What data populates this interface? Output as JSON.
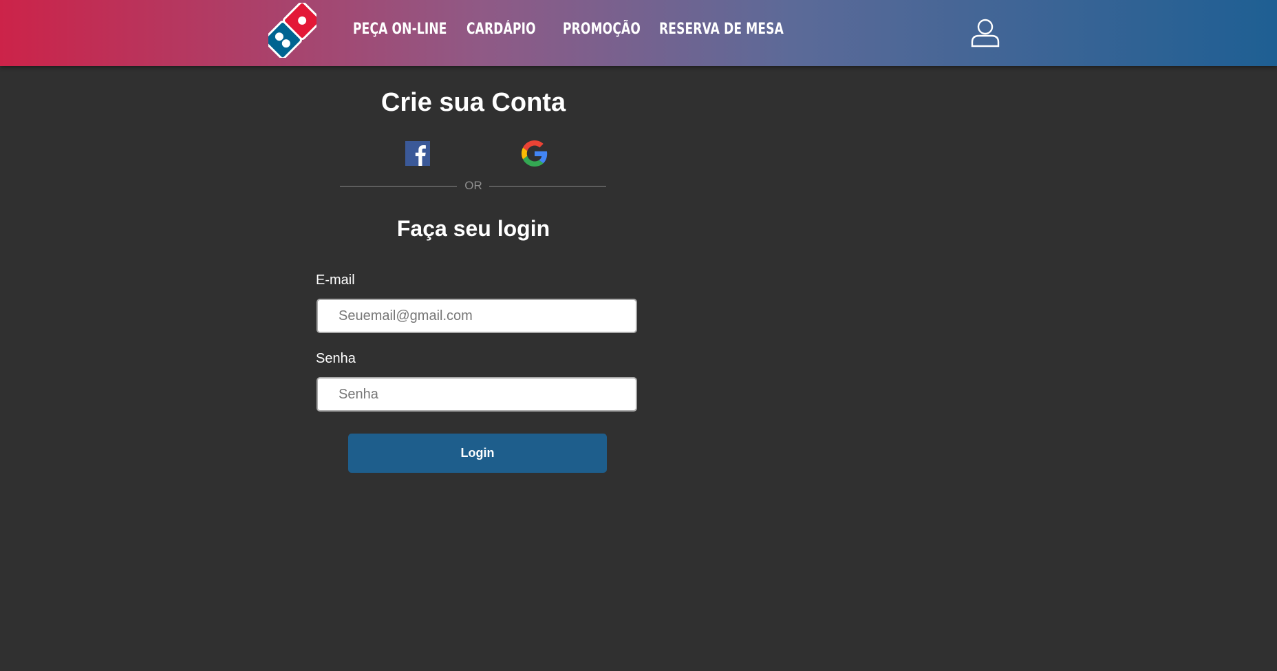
{
  "header": {
    "brand_colors": {
      "red": "#e31837",
      "blue": "#006491"
    },
    "nav": [
      {
        "label": "PEÇA ON-LINE"
      },
      {
        "label": "CARDÁPIO"
      },
      {
        "label": "PROMOÇÃO"
      },
      {
        "label": "RESERVA DE MESA"
      }
    ],
    "user_icon": "user-icon"
  },
  "signup": {
    "title": "Crie sua Conta",
    "social": [
      {
        "icon": "facebook-icon"
      },
      {
        "icon": "google-icon"
      }
    ],
    "separator": "OR"
  },
  "login": {
    "title": "Faça seu login",
    "email_label": "E-mail",
    "email_placeholder": "Seuemail@gmail.com",
    "password_label": "Senha",
    "password_placeholder": "Senha",
    "button_label": "Login"
  },
  "colors": {
    "background": "#303030",
    "button": "#1e5e8c",
    "gradient_start": "#cc2349",
    "gradient_end": "#1e5f93"
  }
}
